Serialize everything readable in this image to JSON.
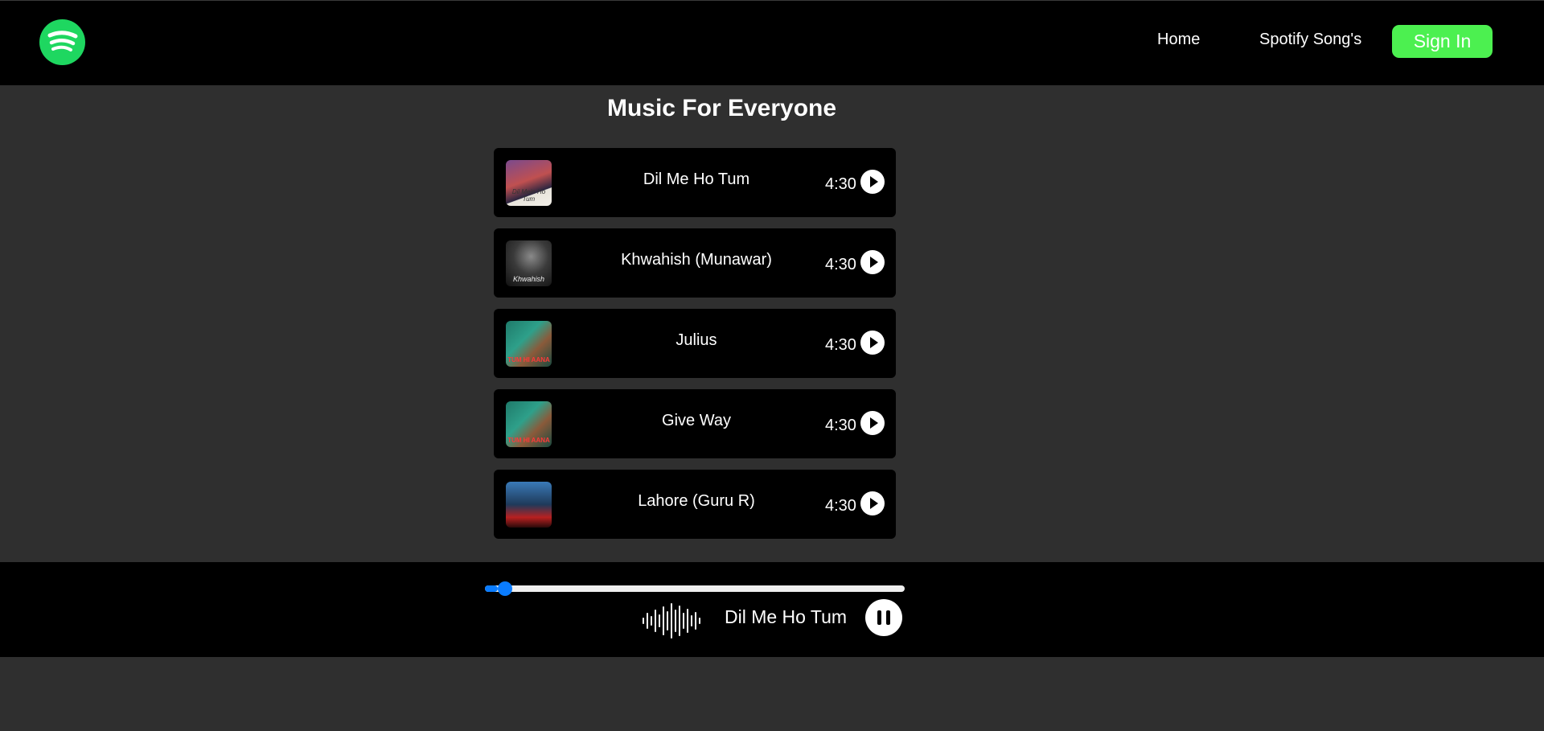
{
  "nav": {
    "logo_icon": "spotify-logo",
    "links": [
      "Home",
      "Spotify Song's"
    ],
    "signin_label": "Sign In"
  },
  "main": {
    "heading": "Music For Everyone"
  },
  "songs": [
    {
      "title": "Dil Me Ho Tum",
      "duration": "4:30",
      "cover_text": "Dil Mein Ho Tum"
    },
    {
      "title": "Khwahish (Munawar)",
      "duration": "4:30",
      "cover_text": "Khwahish"
    },
    {
      "title": "Julius",
      "duration": "4:30",
      "cover_text": "TUM HI AANA"
    },
    {
      "title": "Give Way",
      "duration": "4:30",
      "cover_text": "TUM HI AANA"
    },
    {
      "title": "Lahore (Guru R)",
      "duration": "4:30",
      "cover_text": ""
    }
  ],
  "player": {
    "now_playing": "Dil Me Ho Tum",
    "progress": 0.03,
    "wave_icon": "waveform-icon",
    "state": "playing"
  },
  "colors": {
    "brand": "#1ed760",
    "signin": "#4cf050",
    "slider": "#0a7cff",
    "background": "#2f2f2f"
  }
}
